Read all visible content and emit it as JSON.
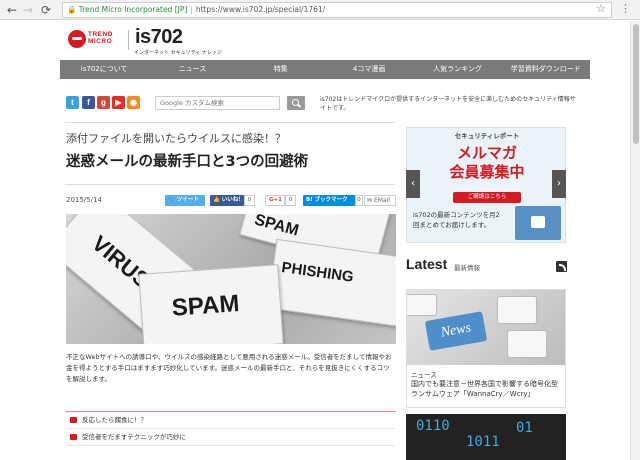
{
  "browser": {
    "site_label": "Trend Micro Incorporated [JP]",
    "url": "https://www.is702.jp/special/1761/"
  },
  "header": {
    "brand_trend": "TREND",
    "brand_micro": "MICRO",
    "logo": "is702",
    "tagline": "インターネット セキュリティ ナレッジ"
  },
  "nav": [
    "is702について",
    "ニュース",
    "特集",
    "4コマ漫画",
    "人気ランキング",
    "学習資料ダウンロード"
  ],
  "search": {
    "placeholder": "Google カスタム検索"
  },
  "site_description": "is702はトレンドマイクロが提供するインターネットを安全に楽しむためのセキュリティ情報サイトです。",
  "article": {
    "subtitle": "添付ファイルを開いたらウイルスに感染！？",
    "title": "迷惑メールの最新手口と3つの回避術",
    "date": "2015/5/14",
    "share": {
      "tweet": "ツイート",
      "like": "いいね！",
      "like_count": "0",
      "gplus": "G+1",
      "gplus_count": "0",
      "hatena": "B! ブックマーク",
      "hatena_count": "0",
      "email": "EMail"
    },
    "hero_words": [
      "VIRUS",
      "SPAM",
      "PHISHING",
      "SPAM"
    ],
    "lead": "不正なWebサイトへの誘導口や、ウイルスの感染経路として悪用される迷惑メール。受信者をだまして情報やお金を得ようとする手口はますます巧妙化しています。迷惑メールの最新手口と、それらを見抜きにくくするコツを解説します。",
    "toc": [
      "反応したら餌食に！？",
      "受信者をだますテクニックが巧妙に"
    ]
  },
  "sidebar": {
    "ad": {
      "label": "セキュリティレポート",
      "title_line1": "メルマガ",
      "title_line2": "会員募集中",
      "button": "ご購読はこちら",
      "text": "is702の最新コンテンツを月2回まとめてお届けします。"
    },
    "latest": {
      "heading": "Latest",
      "sub": "最新情報",
      "card": {
        "category": "ニュース",
        "title": "国内でも要注意－世界各国で影響する暗号化型ランサムウェア「WannaCry／Wcry」",
        "key_label": "News"
      }
    }
  }
}
